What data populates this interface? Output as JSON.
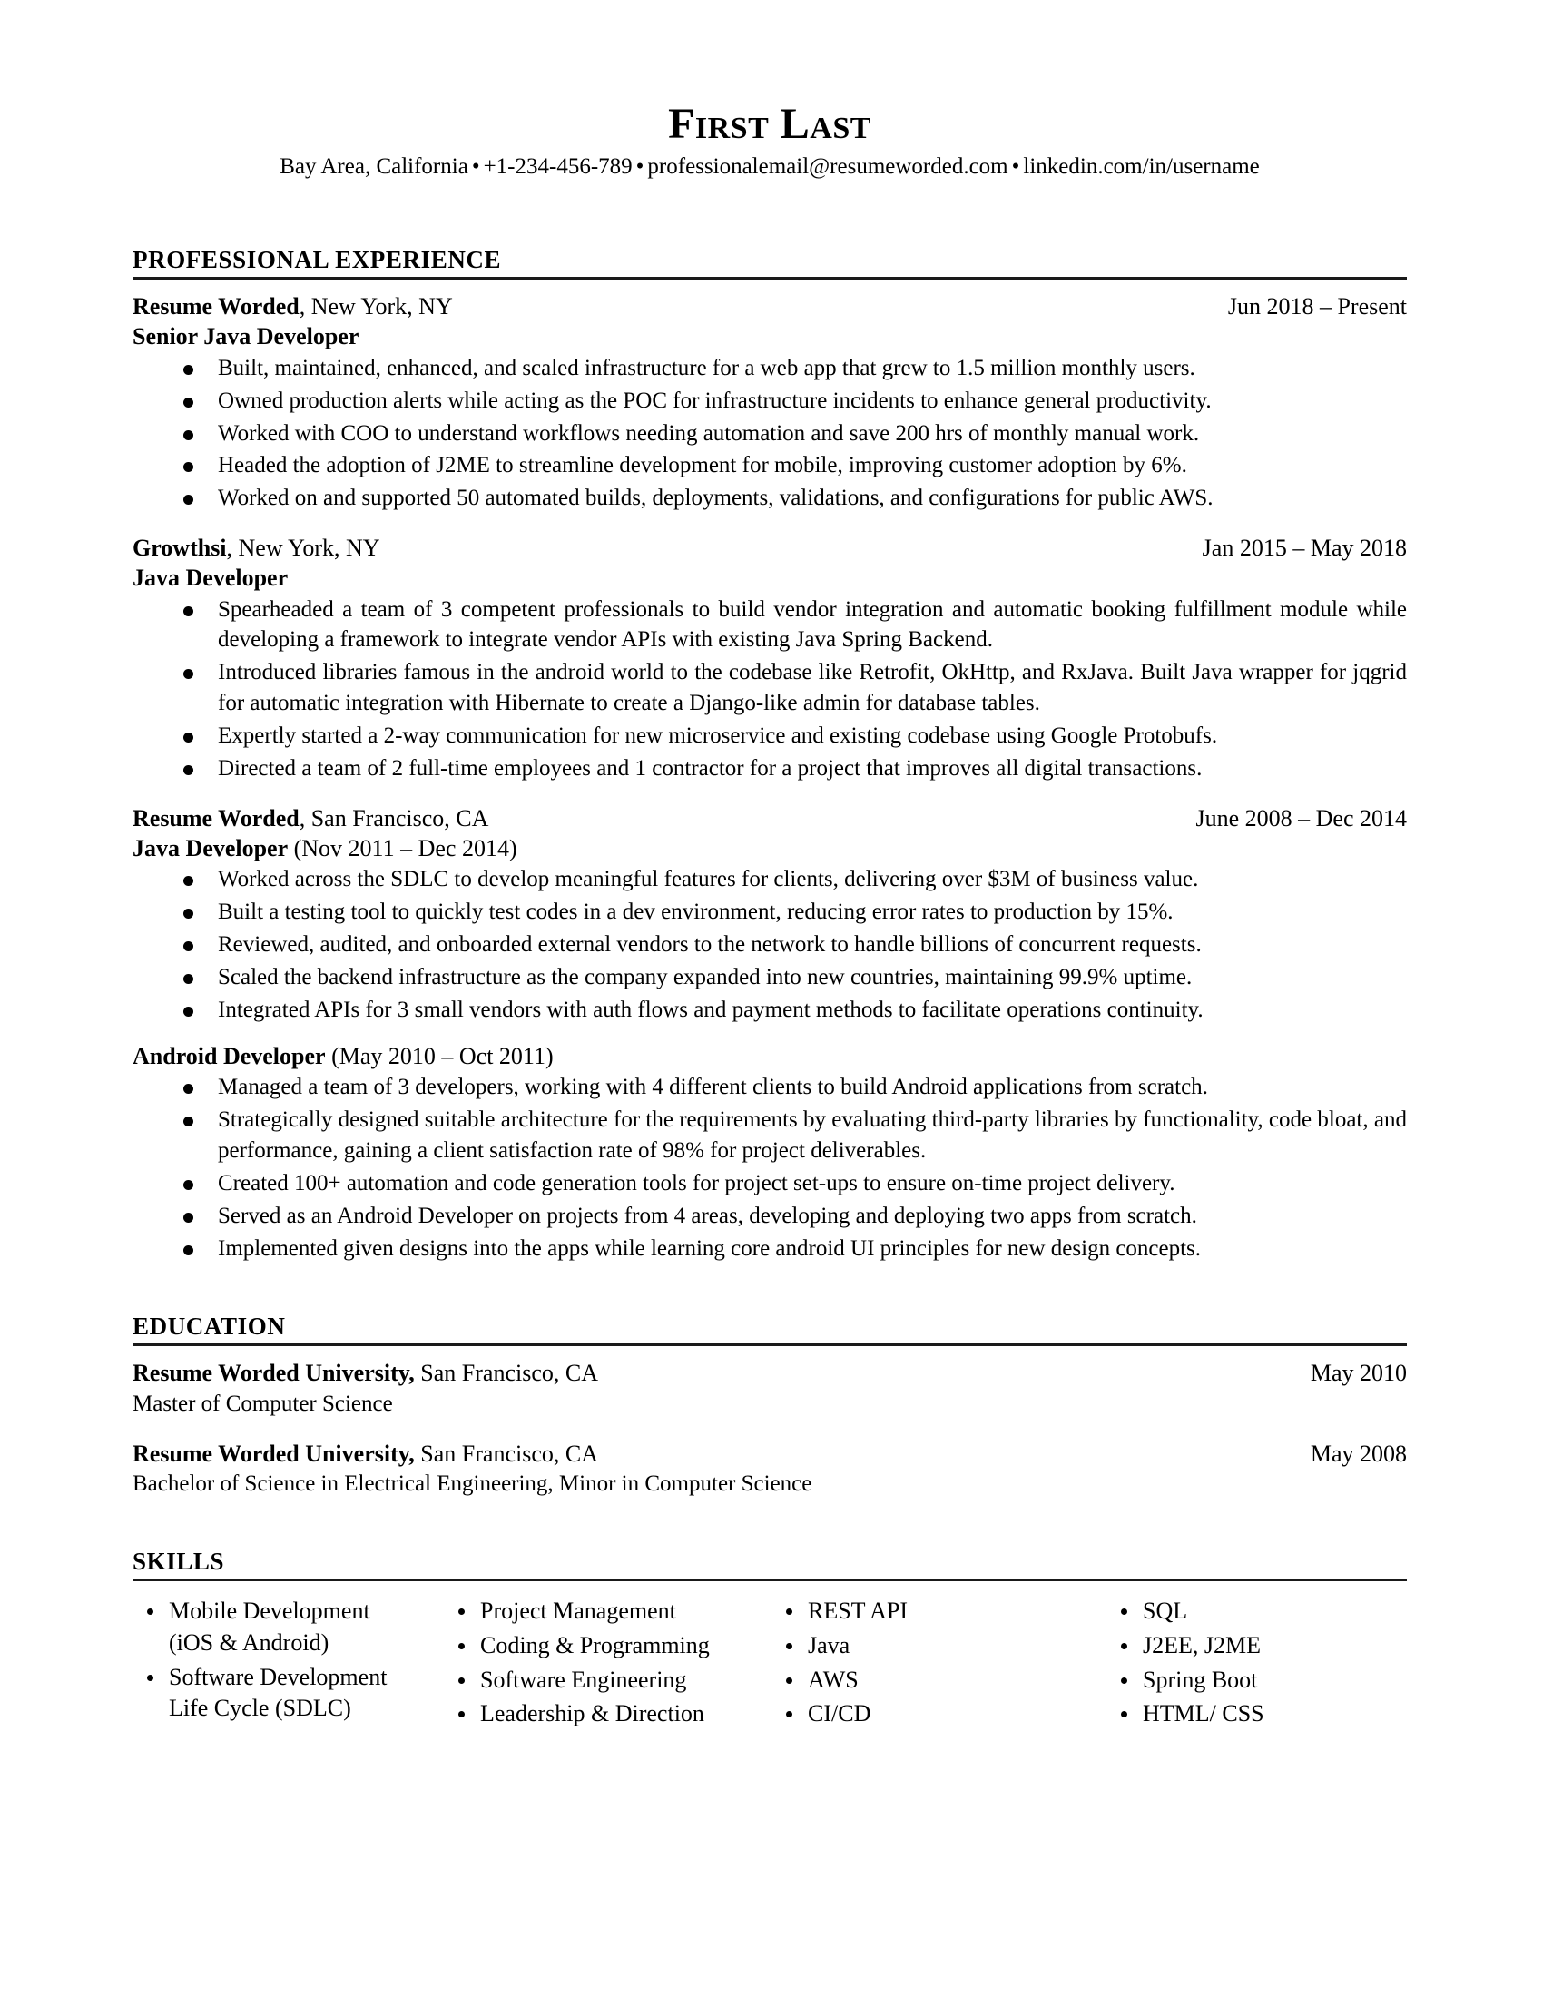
{
  "header": {
    "name": "First Last",
    "contact": {
      "location": "Bay Area, California",
      "phone": "+1-234-456-789",
      "email": "professionalemail@resumeworded.com",
      "linkedin": "linkedin.com/in/username",
      "separator": "•"
    }
  },
  "sections": {
    "experience": {
      "title": "PROFESSIONAL EXPERIENCE",
      "entries": [
        {
          "company": "Resume Worded",
          "location": ", New York, NY",
          "date": "Jun 2018 – Present",
          "roles": [
            {
              "title": "Senior Java Developer",
              "span": "",
              "bullets": [
                "Built, maintained, enhanced, and scaled infrastructure for a web app that grew to 1.5 million monthly users.",
                "Owned production alerts while acting as the POC for infrastructure incidents to enhance general productivity.",
                "Worked with COO to understand workflows needing automation and save 200 hrs of monthly manual work.",
                "Headed the adoption of J2ME to streamline development for mobile, improving customer adoption by 6%.",
                "Worked on and supported 50 automated builds, deployments, validations, and configurations for public AWS."
              ]
            }
          ]
        },
        {
          "company": "Growthsi",
          "location": ", New York, NY",
          "date": "Jan 2015 – May 2018",
          "roles": [
            {
              "title": "Java Developer",
              "span": "",
              "bullets": [
                "Spearheaded a team of 3 competent professionals to build vendor integration and automatic booking fulfillment module while developing a framework to integrate vendor APIs with existing Java Spring Backend.",
                "Introduced libraries famous in the android world to the codebase like Retrofit, OkHttp, and RxJava. Built Java wrapper for jqgrid for automatic integration with Hibernate to create a Django-like admin for database tables.",
                "Expertly started a 2-way communication for new microservice and existing codebase using Google Protobufs.",
                "Directed a team of 2 full-time employees and 1 contractor for a project that improves all digital transactions."
              ]
            }
          ]
        },
        {
          "company": "Resume Worded",
          "location": ", San Francisco, CA",
          "date": "June 2008 – Dec 2014",
          "roles": [
            {
              "title": "Java Developer",
              "span": " (Nov 2011 – Dec 2014)",
              "bullets": [
                "Worked across the SDLC to develop meaningful features for clients, delivering over $3M of business value.",
                "Built a testing tool to quickly test codes in a dev environment, reducing error rates to production by 15%.",
                "Reviewed, audited, and onboarded external vendors to the network to handle billions of concurrent requests.",
                "Scaled the backend infrastructure as the company expanded into new countries, maintaining 99.9% uptime.",
                "Integrated APIs for 3 small vendors with auth flows and payment methods to facilitate operations continuity."
              ]
            },
            {
              "title": "Android Developer",
              "span": " (May 2010 – Oct 2011)",
              "bullets": [
                "Managed a team of 3 developers, working with 4 different clients to build Android applications from scratch.",
                "Strategically designed suitable architecture for the requirements by evaluating third-party libraries by functionality, code bloat, and performance, gaining a client satisfaction rate of 98% for project deliverables.",
                "Created 100+ automation and code generation tools for project set-ups to ensure on-time project delivery.",
                "Served as an Android Developer on projects from 4 areas, developing and deploying two apps from scratch.",
                "Implemented given designs into the apps while learning core android UI principles for new design concepts."
              ]
            }
          ]
        }
      ]
    },
    "education": {
      "title": "EDUCATION",
      "entries": [
        {
          "school": "Resume Worded University,",
          "location": " San Francisco, CA",
          "date": "May 2010",
          "degree": "Master of Computer Science"
        },
        {
          "school": "Resume Worded University,",
          "location": " San Francisco, CA",
          "date": "May 2008",
          "degree": "Bachelor of Science in Electrical Engineering, Minor in Computer Science"
        }
      ]
    },
    "skills": {
      "title": "SKILLS",
      "columns": [
        [
          {
            "text": "Mobile Development",
            "cont": "(iOS & Android)"
          },
          {
            "text": "Software Development",
            "cont": "Life Cycle (SDLC)"
          }
        ],
        [
          {
            "text": "Project Management",
            "cont": ""
          },
          {
            "text": "Coding & Programming",
            "cont": ""
          },
          {
            "text": "Software Engineering",
            "cont": ""
          },
          {
            "text": "Leadership & Direction",
            "cont": ""
          }
        ],
        [
          {
            "text": "REST API",
            "cont": ""
          },
          {
            "text": "Java",
            "cont": ""
          },
          {
            "text": "AWS",
            "cont": ""
          },
          {
            "text": "CI/CD",
            "cont": ""
          }
        ],
        [
          {
            "text": "SQL",
            "cont": ""
          },
          {
            "text": "J2EE, J2ME",
            "cont": ""
          },
          {
            "text": "Spring Boot",
            "cont": ""
          },
          {
            "text": "HTML/ CSS",
            "cont": ""
          }
        ]
      ]
    }
  }
}
